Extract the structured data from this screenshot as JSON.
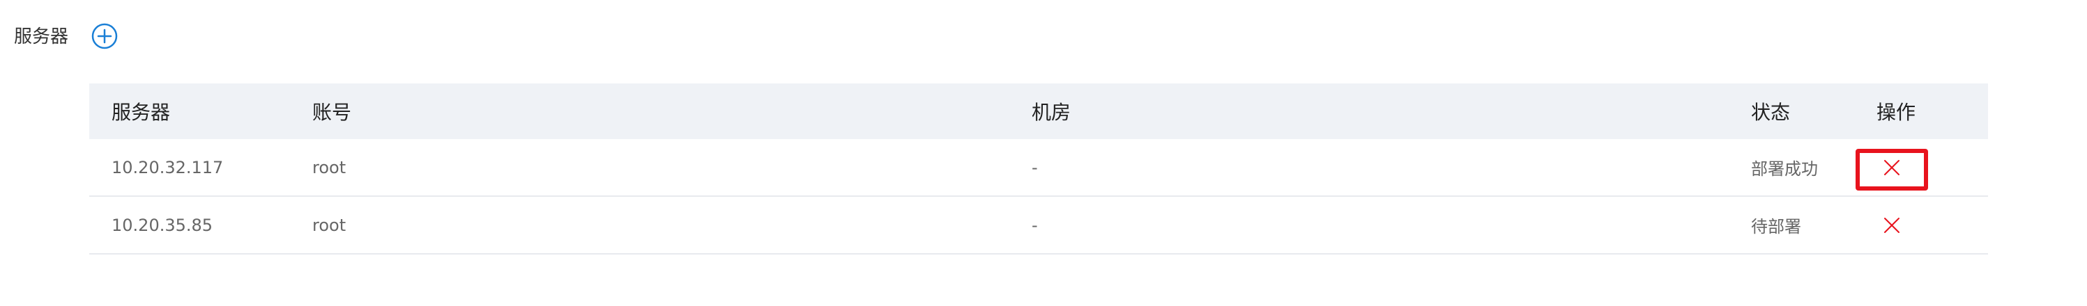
{
  "section": {
    "label": "服务器"
  },
  "icons": {
    "add": "plus-circle-icon",
    "delete": "close-icon"
  },
  "colors": {
    "accent": "#1a7fd6",
    "delete": "#e8131d",
    "header_bg": "#eff2f6",
    "highlight": "#e8131d"
  },
  "table": {
    "columns": {
      "server": "服务器",
      "account": "账号",
      "room": "机房",
      "status": "状态",
      "action": "操作"
    },
    "rows": [
      {
        "server": "10.20.32.117",
        "account": "root",
        "room": "-",
        "status": "部署成功"
      },
      {
        "server": "10.20.35.85",
        "account": "root",
        "room": "-",
        "status": "待部署"
      }
    ]
  }
}
